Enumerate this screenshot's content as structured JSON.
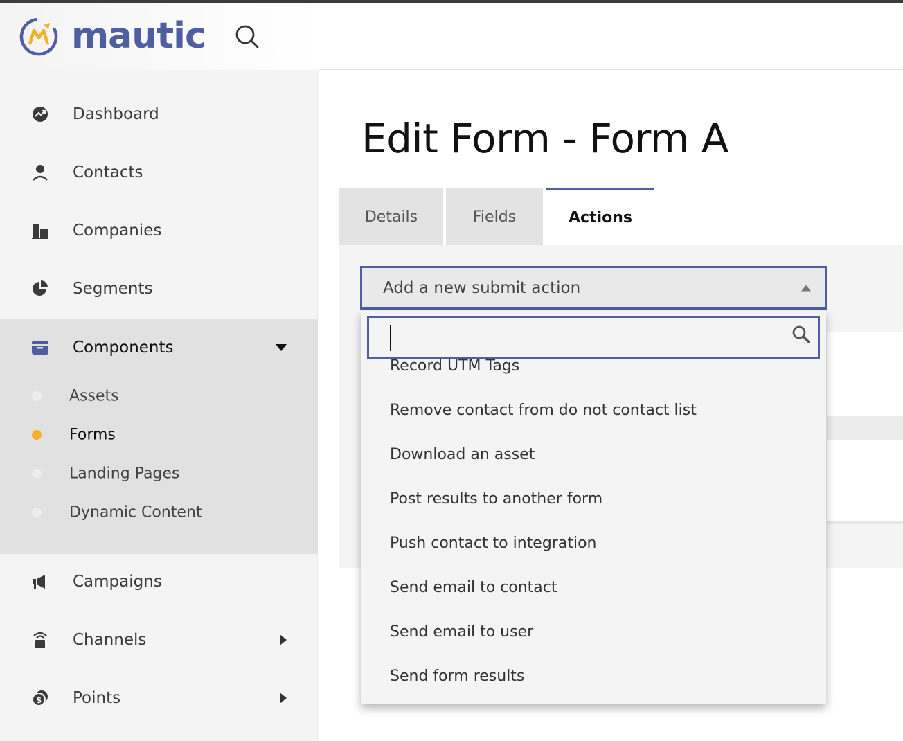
{
  "app": {
    "logo_text": "mautic",
    "brand_color": "#4e5e9e",
    "accent_color": "#f5b027"
  },
  "header": {
    "search_icon": "search-icon"
  },
  "sidebar": {
    "items": [
      {
        "label": "Dashboard",
        "icon": "dashboard-icon"
      },
      {
        "label": "Contacts",
        "icon": "user-icon"
      },
      {
        "label": "Companies",
        "icon": "building-icon"
      },
      {
        "label": "Segments",
        "icon": "pie-chart-icon"
      },
      {
        "label": "Components",
        "icon": "archive-icon",
        "expanded": true
      },
      {
        "label": "Campaigns",
        "icon": "megaphone-icon"
      },
      {
        "label": "Channels",
        "icon": "channels-icon",
        "has_submenu": true
      },
      {
        "label": "Points",
        "icon": "coins-icon",
        "has_submenu": true
      }
    ],
    "components_sub": [
      {
        "label": "Assets",
        "active": false
      },
      {
        "label": "Forms",
        "active": true
      },
      {
        "label": "Landing Pages",
        "active": false
      },
      {
        "label": "Dynamic Content",
        "active": false
      }
    ]
  },
  "main": {
    "title": "Edit Form - Form A",
    "tabs": [
      {
        "label": "Details",
        "active": false
      },
      {
        "label": "Fields",
        "active": false
      },
      {
        "label": "Actions",
        "active": true
      }
    ],
    "submit_action_select": {
      "value": "Add a new submit action",
      "search_value": "",
      "options": [
        "Record UTM Tags",
        "Remove contact from do not contact list",
        "Download an asset",
        "Post results to another form",
        "Push contact to integration",
        "Send email to contact",
        "Send email to user",
        "Send form results"
      ]
    }
  }
}
